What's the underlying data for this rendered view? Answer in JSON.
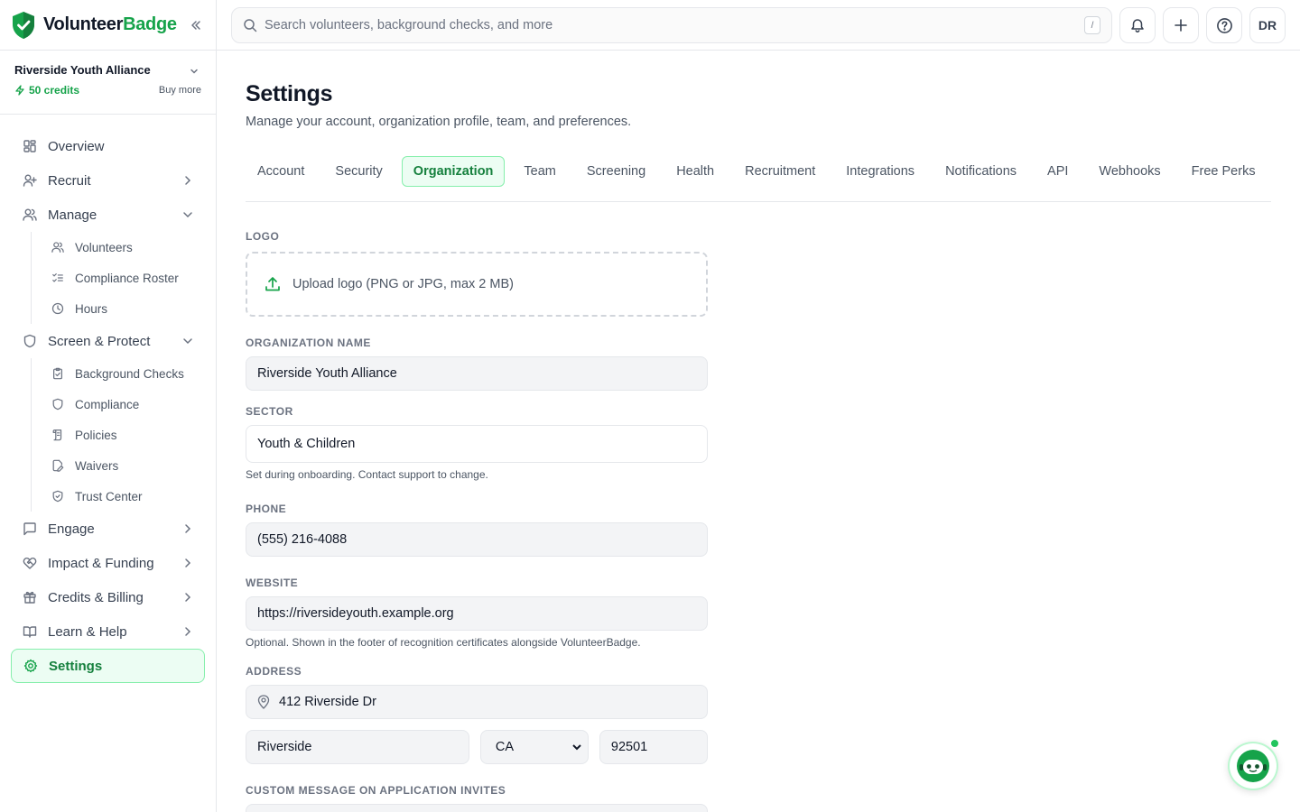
{
  "brand": {
    "name_main": "Volunteer",
    "name_accent": "Badge"
  },
  "org": {
    "name": "Riverside Youth Alliance",
    "credits": "50 credits",
    "buy_more": "Buy more"
  },
  "search": {
    "placeholder": "Search volunteers, background checks, and more",
    "shortcut": "/"
  },
  "topbar": {
    "avatar_initials": "DR"
  },
  "nav": {
    "overview": "Overview",
    "recruit": "Recruit",
    "manage": "Manage",
    "manage_items": [
      "Volunteers",
      "Compliance Roster",
      "Hours"
    ],
    "screen": "Screen & Protect",
    "screen_items": [
      "Background Checks",
      "Compliance",
      "Policies",
      "Waivers",
      "Trust Center"
    ],
    "engage": "Engage",
    "impact": "Impact & Funding",
    "credits": "Credits & Billing",
    "learn": "Learn & Help",
    "settings": "Settings"
  },
  "page": {
    "title": "Settings",
    "subtitle": "Manage your account, organization profile, team, and preferences."
  },
  "tabs": [
    "Account",
    "Security",
    "Organization",
    "Team",
    "Screening",
    "Health",
    "Recruitment",
    "Integrations",
    "Notifications",
    "API",
    "Webhooks",
    "Free Perks"
  ],
  "active_tab": "Organization",
  "form": {
    "logo_label": "Logo",
    "upload_text": "Upload logo (PNG or JPG, max 2 MB)",
    "org_name_label": "Organization Name",
    "org_name_value": "Riverside Youth Alliance",
    "sector_label": "Sector",
    "sector_value": "Youth & Children",
    "sector_help": "Set during onboarding. Contact support to change.",
    "phone_label": "Phone",
    "phone_value": "(555) 216-4088",
    "website_label": "Website",
    "website_value": "https://riversideyouth.example.org",
    "website_help": "Optional. Shown in the footer of recognition certificates alongside VolunteerBadge.",
    "address_label": "Address",
    "street_value": "412 Riverside Dr",
    "city_value": "Riverside",
    "state_value": "CA",
    "zip_value": "92501",
    "custom_message_label": "Custom Message on Application Invites"
  },
  "colors": {
    "accent": "#16a34a",
    "accent_bg": "#ecfdf3",
    "accent_border": "#86efac"
  }
}
